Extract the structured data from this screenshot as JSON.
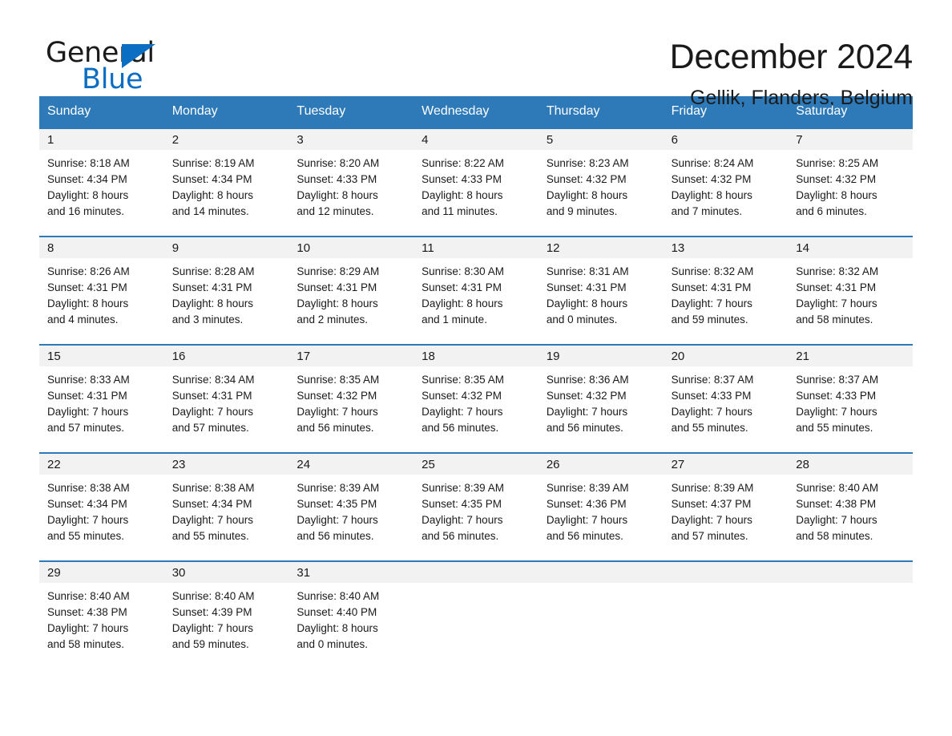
{
  "brand": {
    "name_part1": "General",
    "name_part2": "Blue",
    "accent_color": "#0b6ec2"
  },
  "header": {
    "title": "December 2024",
    "location": "Gellik, Flanders, Belgium"
  },
  "calendar": {
    "header_bg": "#2e7ab8",
    "daynum_bg": "#f2f2f2",
    "weekdays": [
      "Sunday",
      "Monday",
      "Tuesday",
      "Wednesday",
      "Thursday",
      "Friday",
      "Saturday"
    ],
    "weeks": [
      [
        {
          "day": "1",
          "sunrise": "Sunrise: 8:18 AM",
          "sunset": "Sunset: 4:34 PM",
          "daylight1": "Daylight: 8 hours",
          "daylight2": "and 16 minutes."
        },
        {
          "day": "2",
          "sunrise": "Sunrise: 8:19 AM",
          "sunset": "Sunset: 4:34 PM",
          "daylight1": "Daylight: 8 hours",
          "daylight2": "and 14 minutes."
        },
        {
          "day": "3",
          "sunrise": "Sunrise: 8:20 AM",
          "sunset": "Sunset: 4:33 PM",
          "daylight1": "Daylight: 8 hours",
          "daylight2": "and 12 minutes."
        },
        {
          "day": "4",
          "sunrise": "Sunrise: 8:22 AM",
          "sunset": "Sunset: 4:33 PM",
          "daylight1": "Daylight: 8 hours",
          "daylight2": "and 11 minutes."
        },
        {
          "day": "5",
          "sunrise": "Sunrise: 8:23 AM",
          "sunset": "Sunset: 4:32 PM",
          "daylight1": "Daylight: 8 hours",
          "daylight2": "and 9 minutes."
        },
        {
          "day": "6",
          "sunrise": "Sunrise: 8:24 AM",
          "sunset": "Sunset: 4:32 PM",
          "daylight1": "Daylight: 8 hours",
          "daylight2": "and 7 minutes."
        },
        {
          "day": "7",
          "sunrise": "Sunrise: 8:25 AM",
          "sunset": "Sunset: 4:32 PM",
          "daylight1": "Daylight: 8 hours",
          "daylight2": "and 6 minutes."
        }
      ],
      [
        {
          "day": "8",
          "sunrise": "Sunrise: 8:26 AM",
          "sunset": "Sunset: 4:31 PM",
          "daylight1": "Daylight: 8 hours",
          "daylight2": "and 4 minutes."
        },
        {
          "day": "9",
          "sunrise": "Sunrise: 8:28 AM",
          "sunset": "Sunset: 4:31 PM",
          "daylight1": "Daylight: 8 hours",
          "daylight2": "and 3 minutes."
        },
        {
          "day": "10",
          "sunrise": "Sunrise: 8:29 AM",
          "sunset": "Sunset: 4:31 PM",
          "daylight1": "Daylight: 8 hours",
          "daylight2": "and 2 minutes."
        },
        {
          "day": "11",
          "sunrise": "Sunrise: 8:30 AM",
          "sunset": "Sunset: 4:31 PM",
          "daylight1": "Daylight: 8 hours",
          "daylight2": "and 1 minute."
        },
        {
          "day": "12",
          "sunrise": "Sunrise: 8:31 AM",
          "sunset": "Sunset: 4:31 PM",
          "daylight1": "Daylight: 8 hours",
          "daylight2": "and 0 minutes."
        },
        {
          "day": "13",
          "sunrise": "Sunrise: 8:32 AM",
          "sunset": "Sunset: 4:31 PM",
          "daylight1": "Daylight: 7 hours",
          "daylight2": "and 59 minutes."
        },
        {
          "day": "14",
          "sunrise": "Sunrise: 8:32 AM",
          "sunset": "Sunset: 4:31 PM",
          "daylight1": "Daylight: 7 hours",
          "daylight2": "and 58 minutes."
        }
      ],
      [
        {
          "day": "15",
          "sunrise": "Sunrise: 8:33 AM",
          "sunset": "Sunset: 4:31 PM",
          "daylight1": "Daylight: 7 hours",
          "daylight2": "and 57 minutes."
        },
        {
          "day": "16",
          "sunrise": "Sunrise: 8:34 AM",
          "sunset": "Sunset: 4:31 PM",
          "daylight1": "Daylight: 7 hours",
          "daylight2": "and 57 minutes."
        },
        {
          "day": "17",
          "sunrise": "Sunrise: 8:35 AM",
          "sunset": "Sunset: 4:32 PM",
          "daylight1": "Daylight: 7 hours",
          "daylight2": "and 56 minutes."
        },
        {
          "day": "18",
          "sunrise": "Sunrise: 8:35 AM",
          "sunset": "Sunset: 4:32 PM",
          "daylight1": "Daylight: 7 hours",
          "daylight2": "and 56 minutes."
        },
        {
          "day": "19",
          "sunrise": "Sunrise: 8:36 AM",
          "sunset": "Sunset: 4:32 PM",
          "daylight1": "Daylight: 7 hours",
          "daylight2": "and 56 minutes."
        },
        {
          "day": "20",
          "sunrise": "Sunrise: 8:37 AM",
          "sunset": "Sunset: 4:33 PM",
          "daylight1": "Daylight: 7 hours",
          "daylight2": "and 55 minutes."
        },
        {
          "day": "21",
          "sunrise": "Sunrise: 8:37 AM",
          "sunset": "Sunset: 4:33 PM",
          "daylight1": "Daylight: 7 hours",
          "daylight2": "and 55 minutes."
        }
      ],
      [
        {
          "day": "22",
          "sunrise": "Sunrise: 8:38 AM",
          "sunset": "Sunset: 4:34 PM",
          "daylight1": "Daylight: 7 hours",
          "daylight2": "and 55 minutes."
        },
        {
          "day": "23",
          "sunrise": "Sunrise: 8:38 AM",
          "sunset": "Sunset: 4:34 PM",
          "daylight1": "Daylight: 7 hours",
          "daylight2": "and 55 minutes."
        },
        {
          "day": "24",
          "sunrise": "Sunrise: 8:39 AM",
          "sunset": "Sunset: 4:35 PM",
          "daylight1": "Daylight: 7 hours",
          "daylight2": "and 56 minutes."
        },
        {
          "day": "25",
          "sunrise": "Sunrise: 8:39 AM",
          "sunset": "Sunset: 4:35 PM",
          "daylight1": "Daylight: 7 hours",
          "daylight2": "and 56 minutes."
        },
        {
          "day": "26",
          "sunrise": "Sunrise: 8:39 AM",
          "sunset": "Sunset: 4:36 PM",
          "daylight1": "Daylight: 7 hours",
          "daylight2": "and 56 minutes."
        },
        {
          "day": "27",
          "sunrise": "Sunrise: 8:39 AM",
          "sunset": "Sunset: 4:37 PM",
          "daylight1": "Daylight: 7 hours",
          "daylight2": "and 57 minutes."
        },
        {
          "day": "28",
          "sunrise": "Sunrise: 8:40 AM",
          "sunset": "Sunset: 4:38 PM",
          "daylight1": "Daylight: 7 hours",
          "daylight2": "and 58 minutes."
        }
      ],
      [
        {
          "day": "29",
          "sunrise": "Sunrise: 8:40 AM",
          "sunset": "Sunset: 4:38 PM",
          "daylight1": "Daylight: 7 hours",
          "daylight2": "and 58 minutes."
        },
        {
          "day": "30",
          "sunrise": "Sunrise: 8:40 AM",
          "sunset": "Sunset: 4:39 PM",
          "daylight1": "Daylight: 7 hours",
          "daylight2": "and 59 minutes."
        },
        {
          "day": "31",
          "sunrise": "Sunrise: 8:40 AM",
          "sunset": "Sunset: 4:40 PM",
          "daylight1": "Daylight: 8 hours",
          "daylight2": "and 0 minutes."
        },
        {
          "day": "",
          "sunrise": "",
          "sunset": "",
          "daylight1": "",
          "daylight2": ""
        },
        {
          "day": "",
          "sunrise": "",
          "sunset": "",
          "daylight1": "",
          "daylight2": ""
        },
        {
          "day": "",
          "sunrise": "",
          "sunset": "",
          "daylight1": "",
          "daylight2": ""
        },
        {
          "day": "",
          "sunrise": "",
          "sunset": "",
          "daylight1": "",
          "daylight2": ""
        }
      ]
    ]
  }
}
